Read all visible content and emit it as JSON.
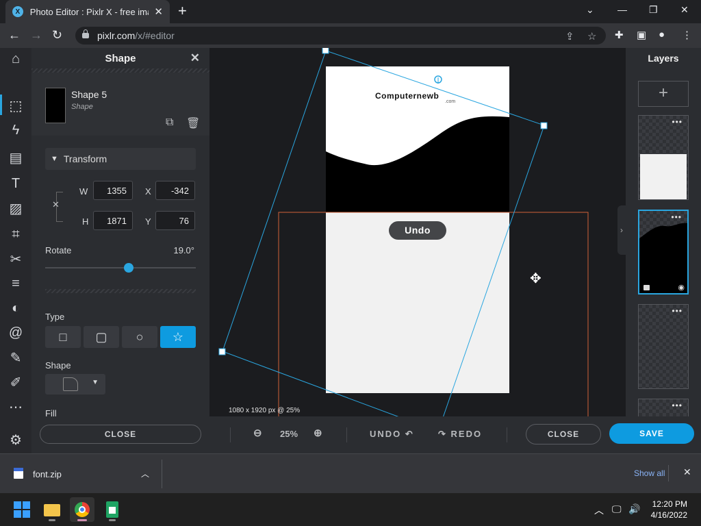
{
  "browser": {
    "tab_title": "Photo Editor : Pixlr X - free image editing online",
    "tab_favicon": "X",
    "url_host": "pixlr.com",
    "url_path": "/x/#editor"
  },
  "left_panel": {
    "title": "Shape",
    "layer_name": "Shape 5",
    "layer_type": "Shape",
    "transform_label": "Transform",
    "w_label": "W",
    "w_value": "1355",
    "x_label": "X",
    "x_value": "-342",
    "h_label": "H",
    "h_value": "1871",
    "y_label": "Y",
    "y_value": "76",
    "rotate_label": "Rotate",
    "rotate_value": "19.0°",
    "rotate_fraction": 0.553,
    "type_label": "Type",
    "shape_label": "Shape",
    "fill_label": "Fill",
    "close_label": "CLOSE"
  },
  "canvas": {
    "logo_text": "Computernewb",
    "logo_sub": ".com",
    "undo_toast": "Undo",
    "doc_size": "1080 x 1920 px @ 25%",
    "accent": "#2aa6e0"
  },
  "bottom_bar": {
    "zoom": "25%",
    "undo_label": "UNDO",
    "redo_label": "REDO",
    "close_label": "CLOSE",
    "save_label": "SAVE"
  },
  "layers": {
    "title": "Layers"
  },
  "downloads": {
    "file_name": "font.zip",
    "show_all": "Show all"
  },
  "taskbar": {
    "time": "12:20 PM",
    "date": "4/16/2022"
  }
}
